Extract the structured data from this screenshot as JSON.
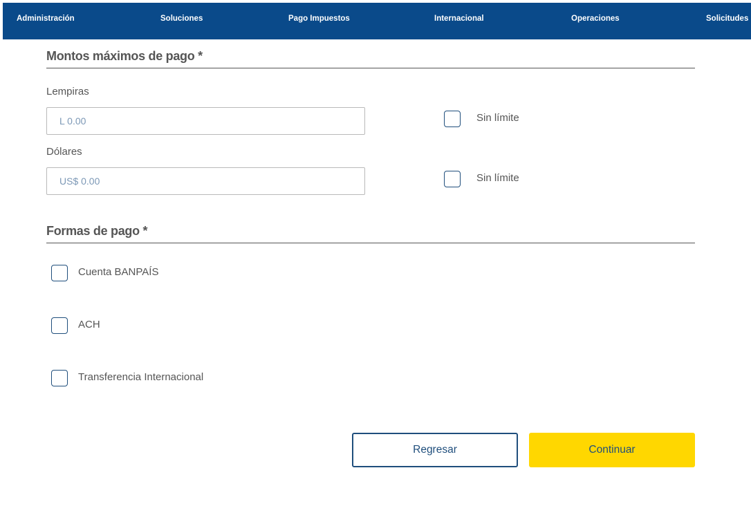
{
  "nav": {
    "items": [
      {
        "label": "Administración"
      },
      {
        "label": "Soluciones"
      },
      {
        "label": "Pago Impuestos"
      },
      {
        "label": "Internacional"
      },
      {
        "label": "Operaciones"
      },
      {
        "label": "Solicitudes"
      }
    ]
  },
  "montos": {
    "title": "Montos máximos de pago *",
    "lempiras": {
      "label": "Lempiras",
      "placeholder": "L 0.00",
      "no_limit_label": "Sin límite"
    },
    "dolares": {
      "label": "Dólares",
      "placeholder": "US$ 0.00",
      "no_limit_label": "Sin límite"
    }
  },
  "formas": {
    "title": "Formas de pago *",
    "options": [
      {
        "label": "Cuenta BANPAÍS"
      },
      {
        "label": "ACH"
      },
      {
        "label": "Transferencia Internacional"
      }
    ]
  },
  "actions": {
    "back_label": "Regresar",
    "continue_label": "Continuar"
  },
  "colors": {
    "nav_bg": "#0a4a8a",
    "primary_button": "#ffd700",
    "accent_text": "#1f4e7c"
  }
}
